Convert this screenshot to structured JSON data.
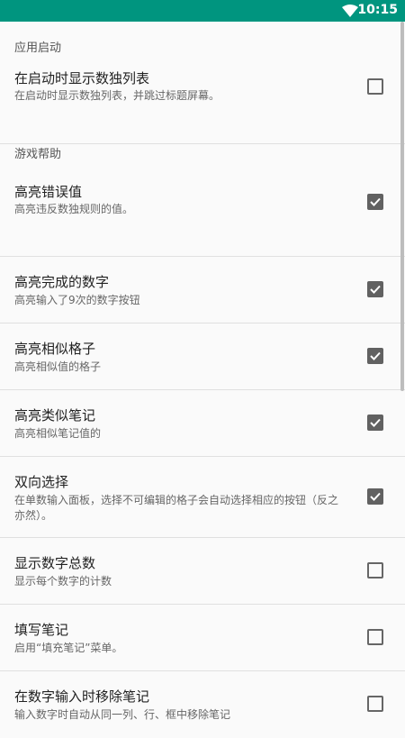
{
  "status_bar": {
    "time": "10:15",
    "wifi_icon": "wifi-icon"
  },
  "sections": {
    "app_start": {
      "header": "应用启动"
    },
    "game_help": {
      "header": "游戏帮助"
    }
  },
  "settings": [
    {
      "title": "在启动时显示数独列表",
      "summary": "在启动时显示数独列表，并跳过标题屏幕。",
      "checked": false
    },
    {
      "title": "高亮错误值",
      "summary": "高亮违反数独规则的值。",
      "checked": true
    },
    {
      "title": "高亮完成的数字",
      "summary": "高亮输入了9次的数字按钮",
      "checked": true
    },
    {
      "title": "高亮相似格子",
      "summary": "高亮相似值的格子",
      "checked": true
    },
    {
      "title": "高亮类似笔记",
      "summary": "高亮相似笔记值的",
      "checked": true
    },
    {
      "title": "双向选择",
      "summary": "在单数输入面板，选择不可编辑的格子会自动选择相应的按钮（反之亦然）。",
      "checked": true
    },
    {
      "title": "显示数字总数",
      "summary": "显示每个数字的计数",
      "checked": false
    },
    {
      "title": "填写笔记",
      "summary": "启用“填充笔记”菜单。",
      "checked": false
    },
    {
      "title": "在数字输入时移除笔记",
      "summary": "输入数字时自动从同一列、行、框中移除笔记",
      "checked": false
    }
  ]
}
